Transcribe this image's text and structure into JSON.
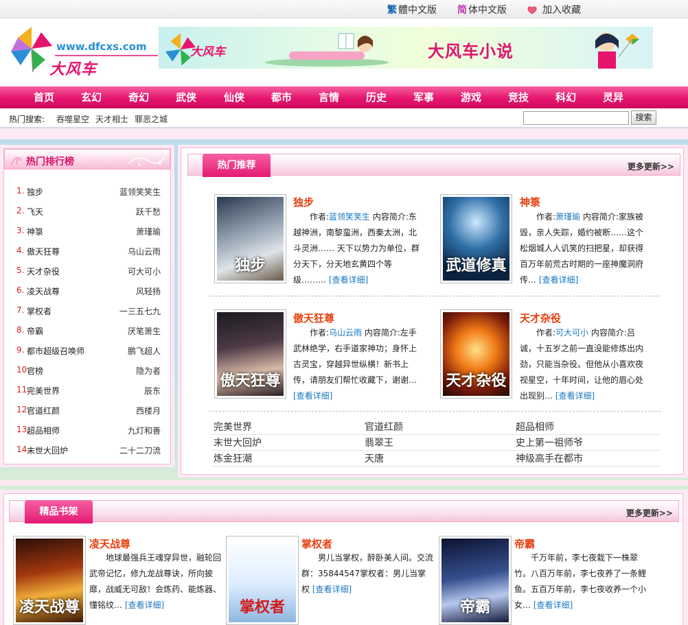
{
  "toplinks": {
    "traditional_mark": "繁",
    "traditional_label": "體中文版",
    "simplified_mark": "简",
    "simplified_label": "体中文版",
    "favorite_label": "加入收藏"
  },
  "header": {
    "logo_url_text": "www.dfcxs.com",
    "logo_text": "大风车",
    "banner_title": "大风车小说"
  },
  "nav": [
    "首页",
    "玄幻",
    "奇幻",
    "武侠",
    "仙侠",
    "都市",
    "言情",
    "历史",
    "军事",
    "游戏",
    "竞技",
    "科幻",
    "灵异"
  ],
  "hotsearch": {
    "label": "热门搜索:",
    "links": [
      "吞噬星空",
      "天才相士",
      "罪恶之城"
    ],
    "search_placeholder": "",
    "search_button": "搜索"
  },
  "ranking": {
    "title": "热门排行榜",
    "items": [
      {
        "num": "1.",
        "title": "独步",
        "author": "蓝领笑笑生"
      },
      {
        "num": "2.",
        "title": "飞天",
        "author": "跃千愁"
      },
      {
        "num": "3.",
        "title": "神箓",
        "author": "萧瑾瑜"
      },
      {
        "num": "4.",
        "title": "傲天狂尊",
        "author": "乌山云雨"
      },
      {
        "num": "5.",
        "title": "天才杂役",
        "author": "可大可小"
      },
      {
        "num": "6.",
        "title": "凌天战尊",
        "author": "风轻扬"
      },
      {
        "num": "7.",
        "title": "掌权者",
        "author": "一三五七九"
      },
      {
        "num": "8.",
        "title": "帝霸",
        "author": "厌笔萧生"
      },
      {
        "num": "9.",
        "title": "都市超级召唤师",
        "author": "鹏飞超人"
      },
      {
        "num": "10.",
        "title": "官榜",
        "author": "隐为者"
      },
      {
        "num": "11.",
        "title": "完美世界",
        "author": "辰东"
      },
      {
        "num": "12.",
        "title": "官道红颜",
        "author": "西楼月"
      },
      {
        "num": "13.",
        "title": "超品相师",
        "author": "九灯和善"
      },
      {
        "num": "14.",
        "title": "末世大回炉",
        "author": "二十二刀流"
      }
    ]
  },
  "recommend": {
    "title": "热门推荐",
    "more": "更多更新>>",
    "books": [
      {
        "title": "独步",
        "author_prefix": "作者:",
        "author": "蓝领笑笑生",
        "intro": "内容简介:东越神洲，南黎蛮洲，西秦太洲，北斗灵洲…… 天下以势力为单位，群分天下，分天地玄黄四个等级……",
        "ellipsis": "…",
        "detail": "[查看详细]",
        "cover_text": "独步"
      },
      {
        "title": "神箓",
        "author_prefix": "作者:",
        "author": "萧瑾瑜",
        "intro": "内容简介:家族被毁，亲人失踪，婚约被断……这个松烟城人人讥笑的扫把星，却获得百万年前荒古时期的一座神魔洞府传…",
        "ellipsis": "",
        "detail": "[查看详细]",
        "cover_text": "武道修真"
      },
      {
        "title": "傲天狂尊",
        "author_prefix": "作者:",
        "author": "乌山云雨",
        "intro": "内容简介:左手武林绝学，右手道家神功；身怀上古灵宝，穿越异世纵横！新书上传，请朋友们帮忙收藏下，谢谢…",
        "ellipsis": "",
        "detail": "[查看详细]",
        "cover_text": "傲天狂尊"
      },
      {
        "title": "天才杂役",
        "author_prefix": "作者:",
        "author": "可大可小",
        "intro": "内容简介:吕诚，十五岁之前一直没能修炼出内劲，只能当杂役。但他从小喜欢夜视星空，十年时间，让他的眉心处出现别…",
        "ellipsis": "",
        "detail": "[查看详细]",
        "cover_text": "天才杂役"
      }
    ],
    "links": [
      "完美世界",
      "官道红颜",
      "超品相师",
      "末世大回炉",
      "翡翠王",
      "史上第一祖师爷",
      "炼金狂潮",
      "天唐",
      "神级高手在都市"
    ]
  },
  "shelf": {
    "title": "精品书架",
    "more": "更多更新>>",
    "books": [
      {
        "title": "凌天战尊",
        "intro": "地球最强兵王魂穿异世，融轮回武帝记忆，修九龙战尊诀，所向披靡，战威无可敌！会炼药、能炼器、懂铭纹…",
        "detail": "[查看详细]",
        "cover_text": "凌天战尊"
      },
      {
        "title": "掌权者",
        "intro": "男儿当掌权，醉卧美人间。交流群：35844547掌权者：男儿当掌权",
        "detail": "[查看详细]",
        "cover_text": "掌权者"
      },
      {
        "title": "帝霸",
        "intro": "千万年前，李七夜栽下一株翠竹。八百万年前，李七夜养了一条鲤鱼。五百万年前，李七夜收养一个小女…",
        "detail": "[查看详细]",
        "cover_text": "帝霸"
      }
    ]
  },
  "colors": {
    "accent": "#e6146d",
    "title_orange": "#e8400f",
    "link_blue": "#1b77c0",
    "rank_red": "#d41f1f"
  }
}
